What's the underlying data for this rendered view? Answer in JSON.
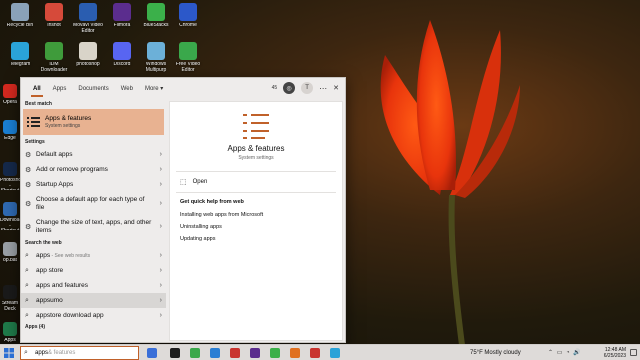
{
  "desktop_icons": [
    {
      "label": "Recycle Bin",
      "color": "#8aa2b8"
    },
    {
      "label": "Inshot",
      "color": "#d64a3a"
    },
    {
      "label": "Movavi Video Editor",
      "color": "#2a5db0"
    },
    {
      "label": "Filmora",
      "color": "#5b2d8e"
    },
    {
      "label": "BlueStacks",
      "color": "#3bb04a"
    },
    {
      "label": "Chrome",
      "color": "#2c58c9"
    },
    {
      "label": "Telegram",
      "color": "#2aa3d8"
    },
    {
      "label": "IDM Downloader",
      "color": "#3f9b3b"
    },
    {
      "label": "photoshop",
      "color": "#d9d4c9"
    },
    {
      "label": "Discord",
      "color": "#5865f2"
    },
    {
      "label": "Windows Multipurp",
      "color": "#6cb0d8"
    },
    {
      "label": "Free Video Editor",
      "color": "#3aa84b"
    }
  ],
  "left_icons": [
    {
      "label": "Opera",
      "color": "#d4291f"
    },
    {
      "label": "Edge",
      "color": "#1a7fd4"
    },
    {
      "label": "Photoshop - Shortcut",
      "color": "#15294a"
    },
    {
      "label": "Downloads - Shortcut",
      "color": "#2f6ab3"
    },
    {
      "label": "op.bat",
      "color": "#9aa0a6"
    },
    {
      "label": "Stream Deck",
      "color": "#1a1a1a"
    },
    {
      "label": "Apps",
      "color": "#1f7a4a"
    }
  ],
  "search": {
    "tabs": [
      "All",
      "Apps",
      "Documents",
      "Web",
      "More ▾"
    ],
    "points": "45",
    "avatar_initial": "T",
    "menu_icon": "ellipsis-icon",
    "close_glyph": "✕",
    "best_match_heading": "Best match",
    "best_match": {
      "title": "Apps & features",
      "subtitle": "System settings"
    },
    "settings_heading": "Settings",
    "settings": [
      "Default apps",
      "Add or remove programs",
      "Startup Apps",
      "Choose a default app for each type of file",
      "Change the size of text, apps, and other items"
    ],
    "web_heading": "Search the web",
    "web": [
      {
        "text": "apps",
        "hint": " - See web results"
      },
      {
        "text": "app store",
        "hint": ""
      },
      {
        "text": "apps and features",
        "hint": ""
      },
      {
        "text": "appsumo",
        "hint": ""
      },
      {
        "text": "appstore download app",
        "hint": ""
      }
    ],
    "apps_count_heading": "Apps (4)",
    "preview": {
      "title": "Apps & features",
      "subtitle": "System settings",
      "open_label": "Open",
      "help_heading": "Get quick help from web",
      "help_links": [
        "Installing web apps from Microsoft",
        "Uninstalling apps",
        "Updating apps"
      ]
    }
  },
  "taskbar": {
    "search_typed": "apps",
    "search_ghost": "& features",
    "weather": "75°F Mostly cloudy",
    "time": "12:48 AM",
    "date": "6/25/2023",
    "app_colors": [
      "#3a6fd8",
      "#1e1e1e",
      "#3aa84b",
      "#2a7fd4",
      "#c9342e",
      "#5b2d8e",
      "#3bb04a",
      "#e07020",
      "#c9342e",
      "#2aa3d8"
    ]
  }
}
